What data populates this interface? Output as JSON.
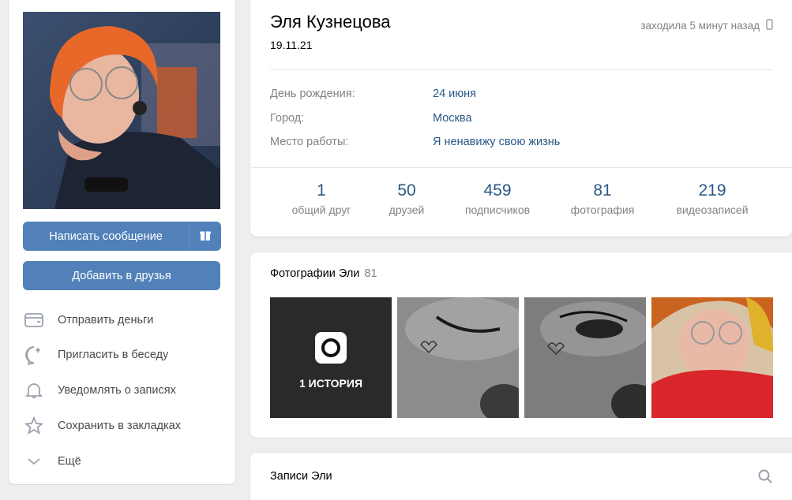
{
  "profile": {
    "name": "Эля Кузнецова",
    "status": "19.11.21",
    "last_seen": "заходила 5 минут назад",
    "info": [
      {
        "label": "День рождения:",
        "value": "24 июня"
      },
      {
        "label": "Город:",
        "value": "Москва"
      },
      {
        "label": "Место работы:",
        "value": "Я ненавижу свою жизнь"
      }
    ],
    "counters": [
      {
        "num": "1",
        "label": "общий друг"
      },
      {
        "num": "50",
        "label": "друзей"
      },
      {
        "num": "459",
        "label": "подписчиков"
      },
      {
        "num": "81",
        "label": "фотография"
      },
      {
        "num": "219",
        "label": "видеозаписей"
      }
    ]
  },
  "sidebar": {
    "write_message": "Написать сообщение",
    "add_friend": "Добавить в друзья",
    "actions": [
      {
        "label": "Отправить деньги",
        "icon": "wallet-icon"
      },
      {
        "label": "Пригласить в беседу",
        "icon": "chat-plus-icon"
      },
      {
        "label": "Уведомлять о записях",
        "icon": "bell-icon"
      },
      {
        "label": "Сохранить в закладках",
        "icon": "star-icon"
      },
      {
        "label": "Ещё",
        "icon": "chevron-down-icon"
      }
    ]
  },
  "photos": {
    "title": "Фотографии Эли",
    "count": "81",
    "story_label": "1 ИСТОРИЯ"
  },
  "posts": {
    "title": "Записи Эли"
  },
  "colors": {
    "accent": "#5181b8",
    "link": "#2a5885",
    "muted": "#828282",
    "background": "#edeef0"
  }
}
